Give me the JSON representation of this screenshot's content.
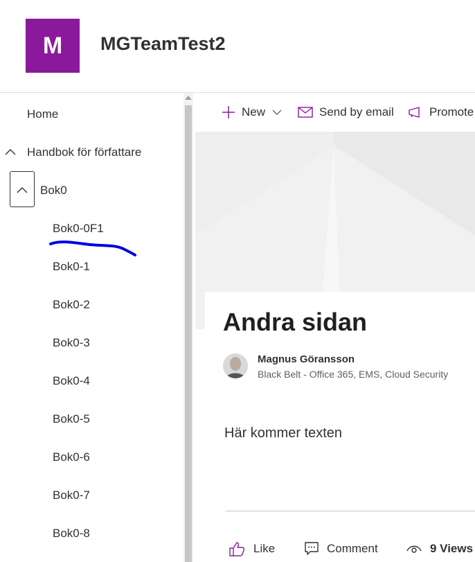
{
  "site": {
    "logo_letter": "M",
    "title": "MGTeamTest2",
    "brand_color": "#8a1a9b"
  },
  "nav": {
    "home": "Home",
    "section": "Handbok för författare",
    "book": "Bok0",
    "pages": [
      "Bok0-0F1",
      "Bok0-1",
      "Bok0-2",
      "Bok0-3",
      "Bok0-4",
      "Bok0-5",
      "Bok0-6",
      "Bok0-7",
      "Bok0-8"
    ]
  },
  "commands": {
    "new": "New",
    "send_email": "Send by email",
    "promote": "Promote"
  },
  "page": {
    "title": "Andra sidan",
    "body": "Här kommer texten"
  },
  "author": {
    "name": "Magnus Göransson",
    "role": "Black Belt - Office 365, EMS, Cloud Security"
  },
  "actions": {
    "like": "Like",
    "comment": "Comment",
    "views": "9 Views"
  },
  "icons": [
    "chevron-up-icon",
    "plus-icon",
    "chevron-down-icon",
    "mail-icon",
    "megaphone-icon",
    "like-icon",
    "comment-icon",
    "views-icon"
  ]
}
